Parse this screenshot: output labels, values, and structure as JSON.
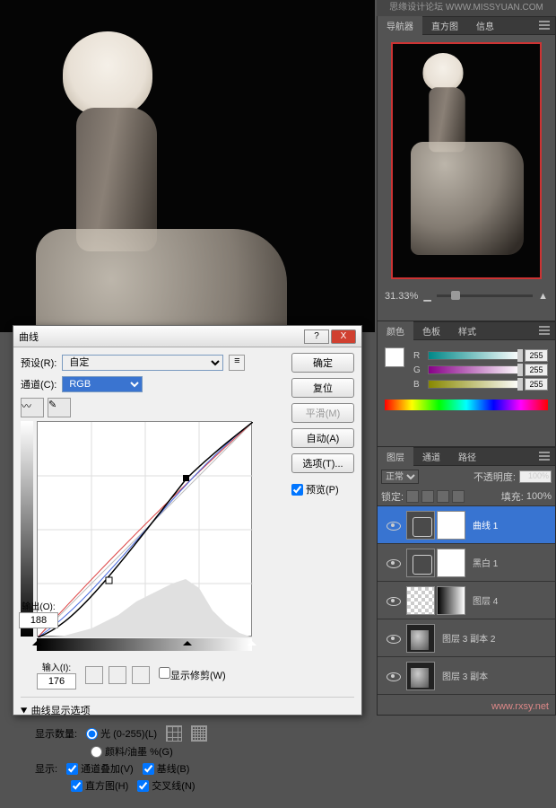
{
  "top_title": "思缘设计论坛   WWW.MISSYUAN.COM",
  "watermark": "www.rxsy.net",
  "navigator": {
    "tabs": [
      "导航器",
      "直方图",
      "信息"
    ],
    "zoom": "31.33%"
  },
  "color": {
    "tabs": [
      "颜色",
      "色板",
      "样式"
    ],
    "r": "255",
    "g": "255",
    "b": "255"
  },
  "layers": {
    "tabs": [
      "图层",
      "通道",
      "路径"
    ],
    "blend": "正常",
    "opacity_label": "不透明度:",
    "opacity": "100%",
    "lock_label": "锁定:",
    "fill_label": "填充:",
    "fill": "100%",
    "items": [
      {
        "name": "曲线 1"
      },
      {
        "name": "黑白 1"
      },
      {
        "name": "图层 4"
      },
      {
        "name": "图层 3 副本 2"
      },
      {
        "name": "图层 3 副本"
      }
    ]
  },
  "curves": {
    "title": "曲线",
    "preset_label": "预设(R):",
    "preset_value": "自定",
    "channel_label": "通道(C):",
    "channel_value": "RGB",
    "ok": "确定",
    "cancel": "复位",
    "smooth": "平滑(M)",
    "auto": "自动(A)",
    "options": "选项(T)...",
    "preview": "预览(P)",
    "output_label": "输出(O):",
    "output_value": "188",
    "input_label": "输入(I):",
    "input_value": "176",
    "show_clipping": "显示修剪(W)",
    "disclosure": "曲线显示选项",
    "show_amount_label": "显示数量:",
    "show_amount_light": "光 (0-255)(L)",
    "show_amount_ink": "颜料/油墨 %(G)",
    "show_label": "显示:",
    "show_channel": "通道叠加(V)",
    "show_baseline": "基线(B)",
    "show_histogram": "直方图(H)",
    "show_intersection": "交叉线(N)"
  },
  "chart_data": {
    "type": "line",
    "title": "曲线",
    "xlabel": "输入",
    "ylabel": "输出",
    "xlim": [
      0,
      255
    ],
    "ylim": [
      0,
      255
    ],
    "series": [
      {
        "name": "RGB",
        "points": [
          [
            0,
            0
          ],
          [
            32,
            20
          ],
          [
            84,
            70
          ],
          [
            176,
            188
          ],
          [
            235,
            245
          ],
          [
            255,
            255
          ]
        ]
      },
      {
        "name": "baseline",
        "points": [
          [
            0,
            0
          ],
          [
            255,
            255
          ]
        ]
      },
      {
        "name": "R",
        "points": [
          [
            0,
            0
          ],
          [
            128,
            140
          ],
          [
            255,
            255
          ]
        ]
      },
      {
        "name": "B",
        "points": [
          [
            0,
            0
          ],
          [
            90,
            70
          ],
          [
            180,
            185
          ],
          [
            255,
            255
          ]
        ]
      }
    ],
    "current_point": {
      "input": 176,
      "output": 188
    }
  }
}
